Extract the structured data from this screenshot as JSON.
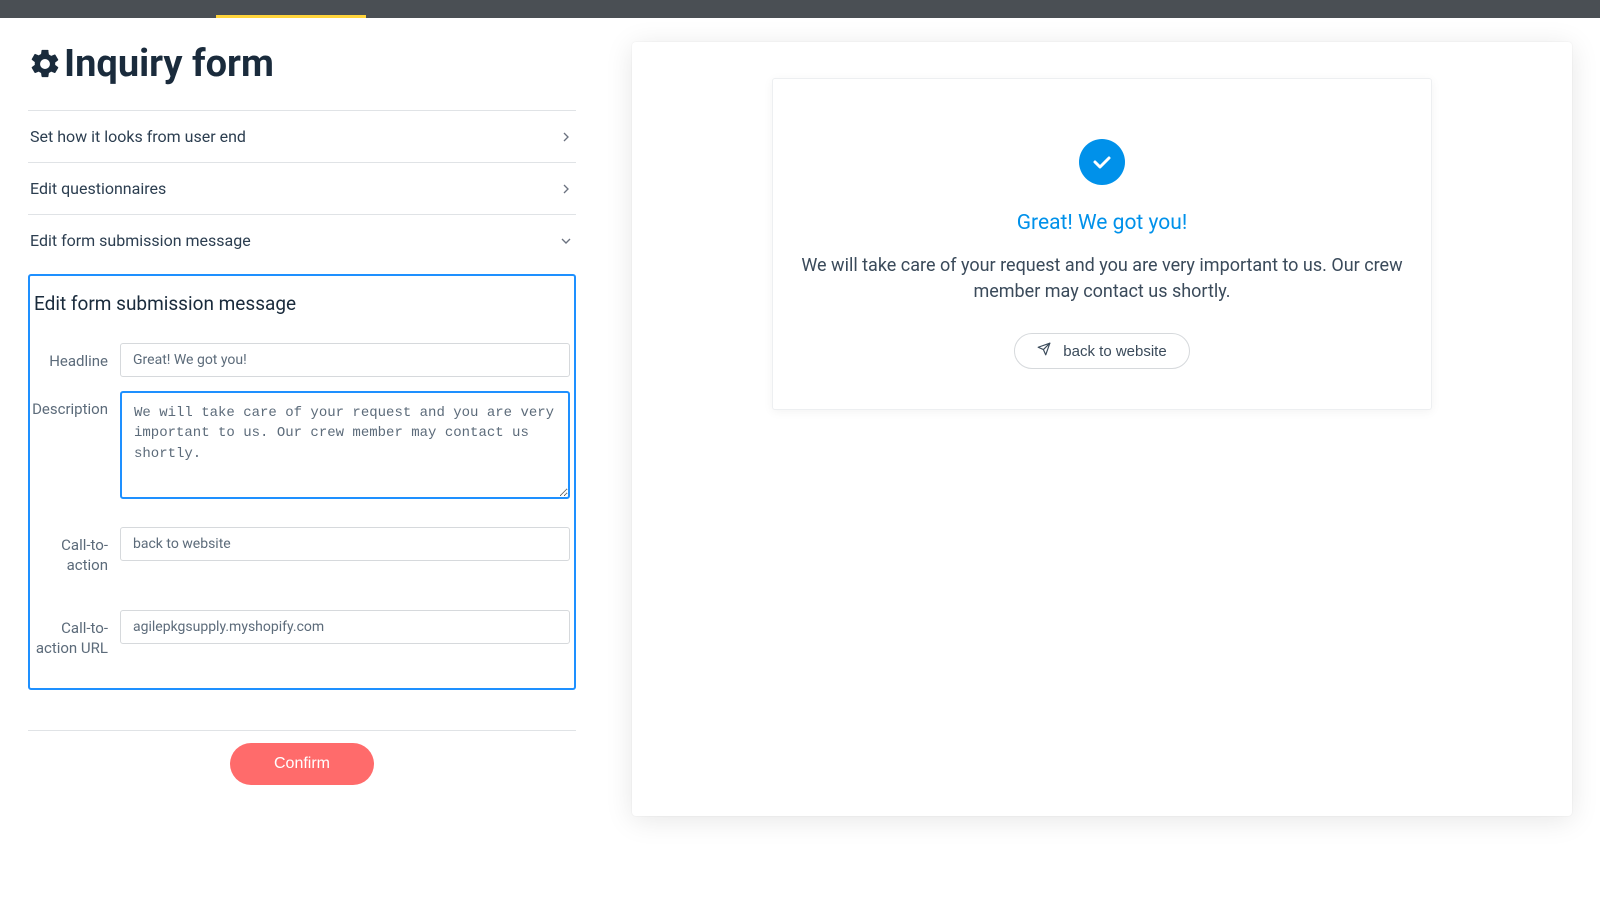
{
  "header": {
    "title": "Inquiry form"
  },
  "accordion": {
    "item1_label": "Set how it looks from user end",
    "item2_label": "Edit questionnaires",
    "item3_label": "Edit form submission message"
  },
  "panel": {
    "title": "Edit form submission message",
    "fields": {
      "headline_label": "Headline",
      "headline_value": "Great! We got you!",
      "description_label": "Description",
      "description_value": "We will take care of your request and you are very important to us. Our crew member may contact us shortly.",
      "cta_label": "Call-to-action",
      "cta_value": "back to website",
      "cta_url_label": "Call-to-action URL",
      "cta_url_value": "agilepkgsupply.myshopify.com"
    }
  },
  "actions": {
    "confirm_label": "Confirm"
  },
  "preview": {
    "headline": "Great! We got you!",
    "description": "We will take care of your request and you are very important to us. Our crew member may contact us shortly.",
    "cta_label": "back to website"
  }
}
